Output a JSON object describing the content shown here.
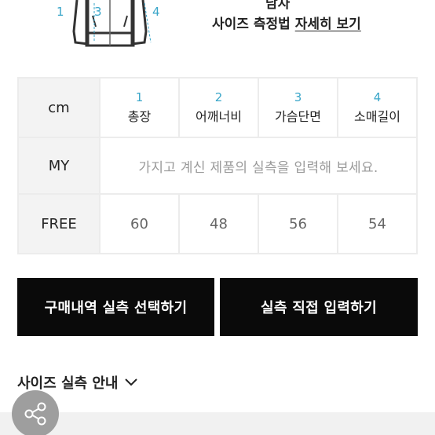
{
  "guide": {
    "numbers": [
      "1",
      "3",
      "4"
    ],
    "top_partial_text": "남자",
    "title_prefix": "사이즈 측정법 ",
    "title_link": "자세히 보기"
  },
  "table": {
    "header_label": "cm",
    "columns": [
      {
        "num": "1",
        "name": "총장"
      },
      {
        "num": "2",
        "name": "어깨너비"
      },
      {
        "num": "3",
        "name": "가슴단면"
      },
      {
        "num": "4",
        "name": "소매길이"
      }
    ],
    "my_row": {
      "label": "MY",
      "placeholder": "가지고 계신 제품의 실측을 입력해 보세요."
    },
    "free_row": {
      "label": "FREE",
      "values": [
        "60",
        "48",
        "56",
        "54"
      ]
    }
  },
  "buttons": {
    "purchase_select": "구매내역 실측 선택하기",
    "direct_input": "실측 직접 입력하기"
  },
  "size_guide": {
    "label": "사이즈 실측 안내"
  },
  "icons": {
    "chevron": "chevron-down-icon",
    "share": "share-icon"
  }
}
